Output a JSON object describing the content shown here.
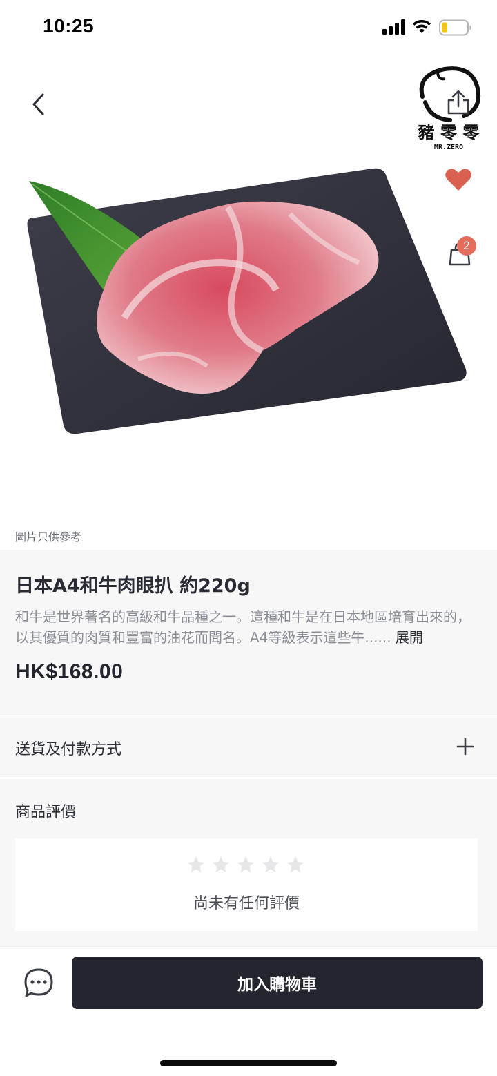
{
  "status_bar": {
    "time": "10:25",
    "icons": [
      "signal-icon",
      "wifi-icon",
      "battery-icon"
    ]
  },
  "hero": {
    "image_note": "圖片只供參考",
    "cart_count": "2",
    "brand_logo": {
      "name": "豬零零",
      "subtitle": "MR.ZERO"
    },
    "icons": [
      "back-arrow-icon",
      "share-icon",
      "heart-icon",
      "shopping-bag-icon"
    ]
  },
  "product": {
    "title": "日本A4和牛肉眼扒 約220g",
    "description": "和牛是世界著名的高級和牛品種之一。這種和牛是在日本地區培育出來的，以其優質的肉質和豐富的油花而聞名。A4等級表示這些牛......",
    "expand_label": "展開",
    "price": "HK$168.00"
  },
  "delivery": {
    "label": "送貨及付款方式"
  },
  "reviews": {
    "title": "商品評價",
    "rating": 0,
    "max_rating": 5,
    "empty_text": "尚未有任何評價"
  },
  "bottom_bar": {
    "add_to_cart_label": "加入購物車"
  },
  "colors": {
    "badge": "#e56d5c",
    "heart": "#d9604f",
    "button_dark": "#23262f",
    "section_bg": "#f7f7f8",
    "battery_fill": "#f2c61f"
  }
}
